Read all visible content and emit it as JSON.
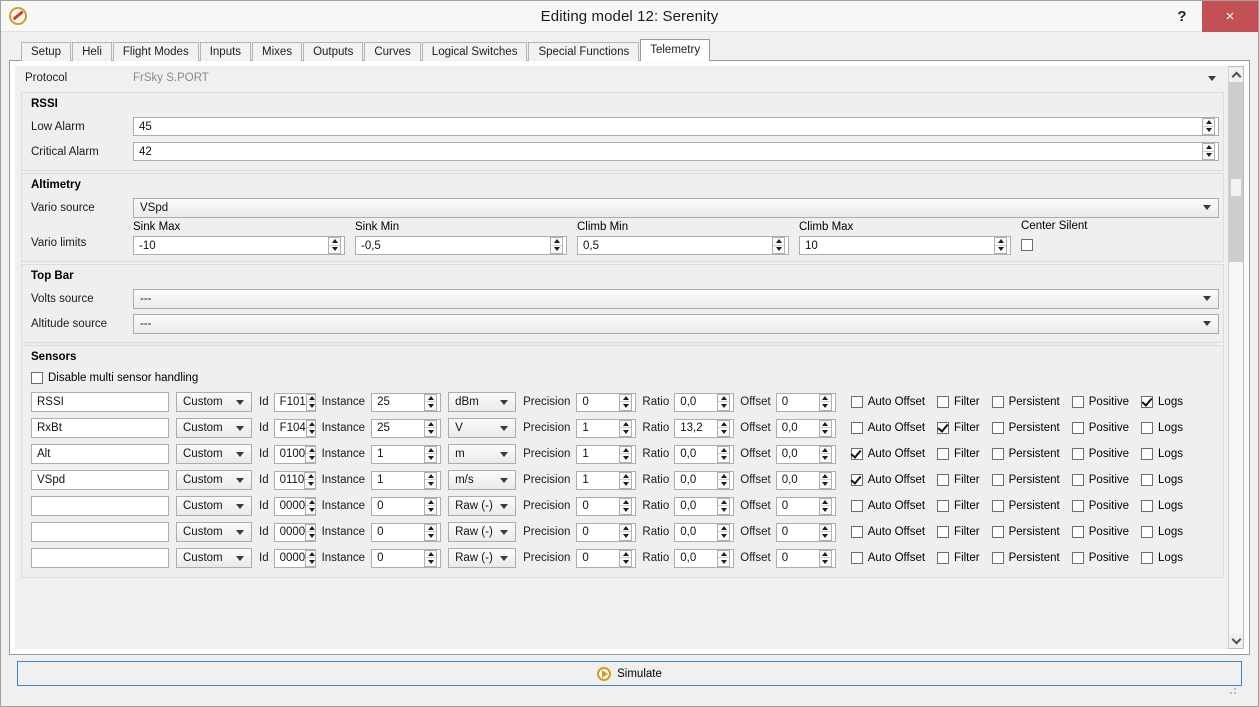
{
  "window": {
    "title": "Editing model 12: Serenity",
    "help_label": "?",
    "close_label": "×",
    "app_icon": "companion-icon"
  },
  "tabs": [
    {
      "label": "Setup",
      "active": false
    },
    {
      "label": "Heli",
      "active": false
    },
    {
      "label": "Flight Modes",
      "active": false
    },
    {
      "label": "Inputs",
      "active": false
    },
    {
      "label": "Mixes",
      "active": false
    },
    {
      "label": "Outputs",
      "active": false
    },
    {
      "label": "Curves",
      "active": false
    },
    {
      "label": "Logical Switches",
      "active": false
    },
    {
      "label": "Special Functions",
      "active": false
    },
    {
      "label": "Telemetry",
      "active": true
    }
  ],
  "protocol": {
    "label": "Protocol",
    "value": "FrSky S.PORT"
  },
  "rssi": {
    "title": "RSSI",
    "low_alarm_label": "Low Alarm",
    "low_alarm_value": "45",
    "critical_alarm_label": "Critical Alarm",
    "critical_alarm_value": "42"
  },
  "altimetry": {
    "title": "Altimetry",
    "vario_source_label": "Vario source",
    "vario_source_value": "VSpd",
    "vario_limits_label": "Vario limits",
    "limits": [
      {
        "caption": "Sink Max",
        "value": "-10"
      },
      {
        "caption": "Sink Min",
        "value": "-0,5"
      },
      {
        "caption": "Climb Min",
        "value": "0,5"
      },
      {
        "caption": "Climb Max",
        "value": "10"
      }
    ],
    "center_silent_label": "Center Silent",
    "center_silent_checked": false
  },
  "topbar": {
    "title": "Top Bar",
    "volts_source_label": "Volts source",
    "volts_source_value": "---",
    "altitude_source_label": "Altitude source",
    "altitude_source_value": "---"
  },
  "sensors": {
    "title": "Sensors",
    "disable_multi_label": "Disable multi sensor handling",
    "disable_multi_checked": false,
    "labels": {
      "id": "Id",
      "instance": "Instance",
      "precision": "Precision",
      "ratio": "Ratio",
      "offset": "Offset",
      "auto_offset": "Auto Offset",
      "filter": "Filter",
      "persistent": "Persistent",
      "positive": "Positive",
      "logs": "Logs"
    },
    "rows": [
      {
        "name": "RSSI",
        "type": "Custom",
        "id": "F101",
        "instance": "25",
        "unit": "dBm",
        "precision": "0",
        "ratio": "0,0",
        "offset": "0",
        "auto_offset": false,
        "filter": false,
        "persistent": false,
        "positive": false,
        "logs": true
      },
      {
        "name": "RxBt",
        "type": "Custom",
        "id": "F104",
        "instance": "25",
        "unit": "V",
        "precision": "1",
        "ratio": "13,2",
        "offset": "0,0",
        "auto_offset": false,
        "filter": true,
        "persistent": false,
        "positive": false,
        "logs": false
      },
      {
        "name": "Alt",
        "type": "Custom",
        "id": "0100",
        "instance": "1",
        "unit": "m",
        "precision": "1",
        "ratio": "0,0",
        "offset": "0,0",
        "auto_offset": true,
        "filter": false,
        "persistent": false,
        "positive": false,
        "logs": false
      },
      {
        "name": "VSpd",
        "type": "Custom",
        "id": "0110",
        "instance": "1",
        "unit": "m/s",
        "precision": "1",
        "ratio": "0,0",
        "offset": "0,0",
        "auto_offset": true,
        "filter": false,
        "persistent": false,
        "positive": false,
        "logs": false
      },
      {
        "name": "",
        "type": "Custom",
        "id": "0000",
        "instance": "0",
        "unit": "Raw (-)",
        "precision": "0",
        "ratio": "0,0",
        "offset": "0",
        "auto_offset": false,
        "filter": false,
        "persistent": false,
        "positive": false,
        "logs": false
      },
      {
        "name": "",
        "type": "Custom",
        "id": "0000",
        "instance": "0",
        "unit": "Raw (-)",
        "precision": "0",
        "ratio": "0,0",
        "offset": "0",
        "auto_offset": false,
        "filter": false,
        "persistent": false,
        "positive": false,
        "logs": false
      },
      {
        "name": "",
        "type": "Custom",
        "id": "0000",
        "instance": "0",
        "unit": "Raw (-)",
        "precision": "0",
        "ratio": "0,0",
        "offset": "0",
        "auto_offset": false,
        "filter": false,
        "persistent": false,
        "positive": false,
        "logs": false
      }
    ]
  },
  "footer": {
    "simulate_label": "Simulate"
  },
  "colors": {
    "close_red": "#c35055",
    "accent_blue": "#3f86c8",
    "play_gold": "#d39b1f"
  }
}
